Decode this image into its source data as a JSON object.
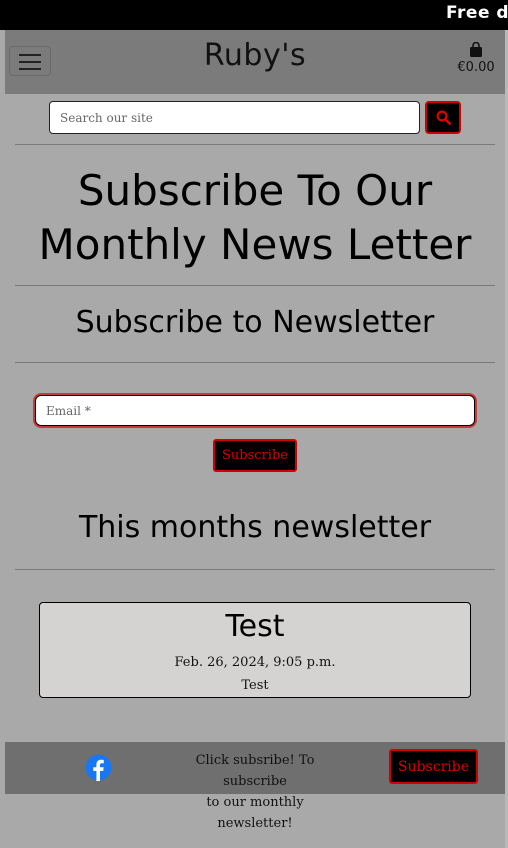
{
  "banner": {
    "text": "Free d"
  },
  "navbar": {
    "brand": "Ruby's",
    "bag_total": "€0.00",
    "menu_icon": "hamburger-icon",
    "bag_icon": "shopping-bag-icon"
  },
  "search": {
    "placeholder": "Search our site",
    "value": "",
    "button_icon": "search-icon"
  },
  "main": {
    "heading": "Subscribe To Our Monthly News Letter",
    "subheading": "Subscribe to Newsletter",
    "email_placeholder": "Email *",
    "email_value": "",
    "subscribe_label": "Subscribe",
    "newsletter_heading": "This months newsletter"
  },
  "newsletter_card": {
    "title": "Test",
    "date": "Feb. 26, 2024, 9:05 p.m.",
    "body": "Test"
  },
  "footer": {
    "social_icon": "facebook-icon",
    "text_line1": "Click subsribe! To subscribe",
    "text_line2": "to our monthly newsletter!",
    "subscribe_label": "Subscribe"
  },
  "colors": {
    "accent": "#d10000",
    "background": "#a9a9a9",
    "navbar": "#7b7b7b",
    "footer": "#6f6f6f",
    "facebook": "#1877f2"
  }
}
